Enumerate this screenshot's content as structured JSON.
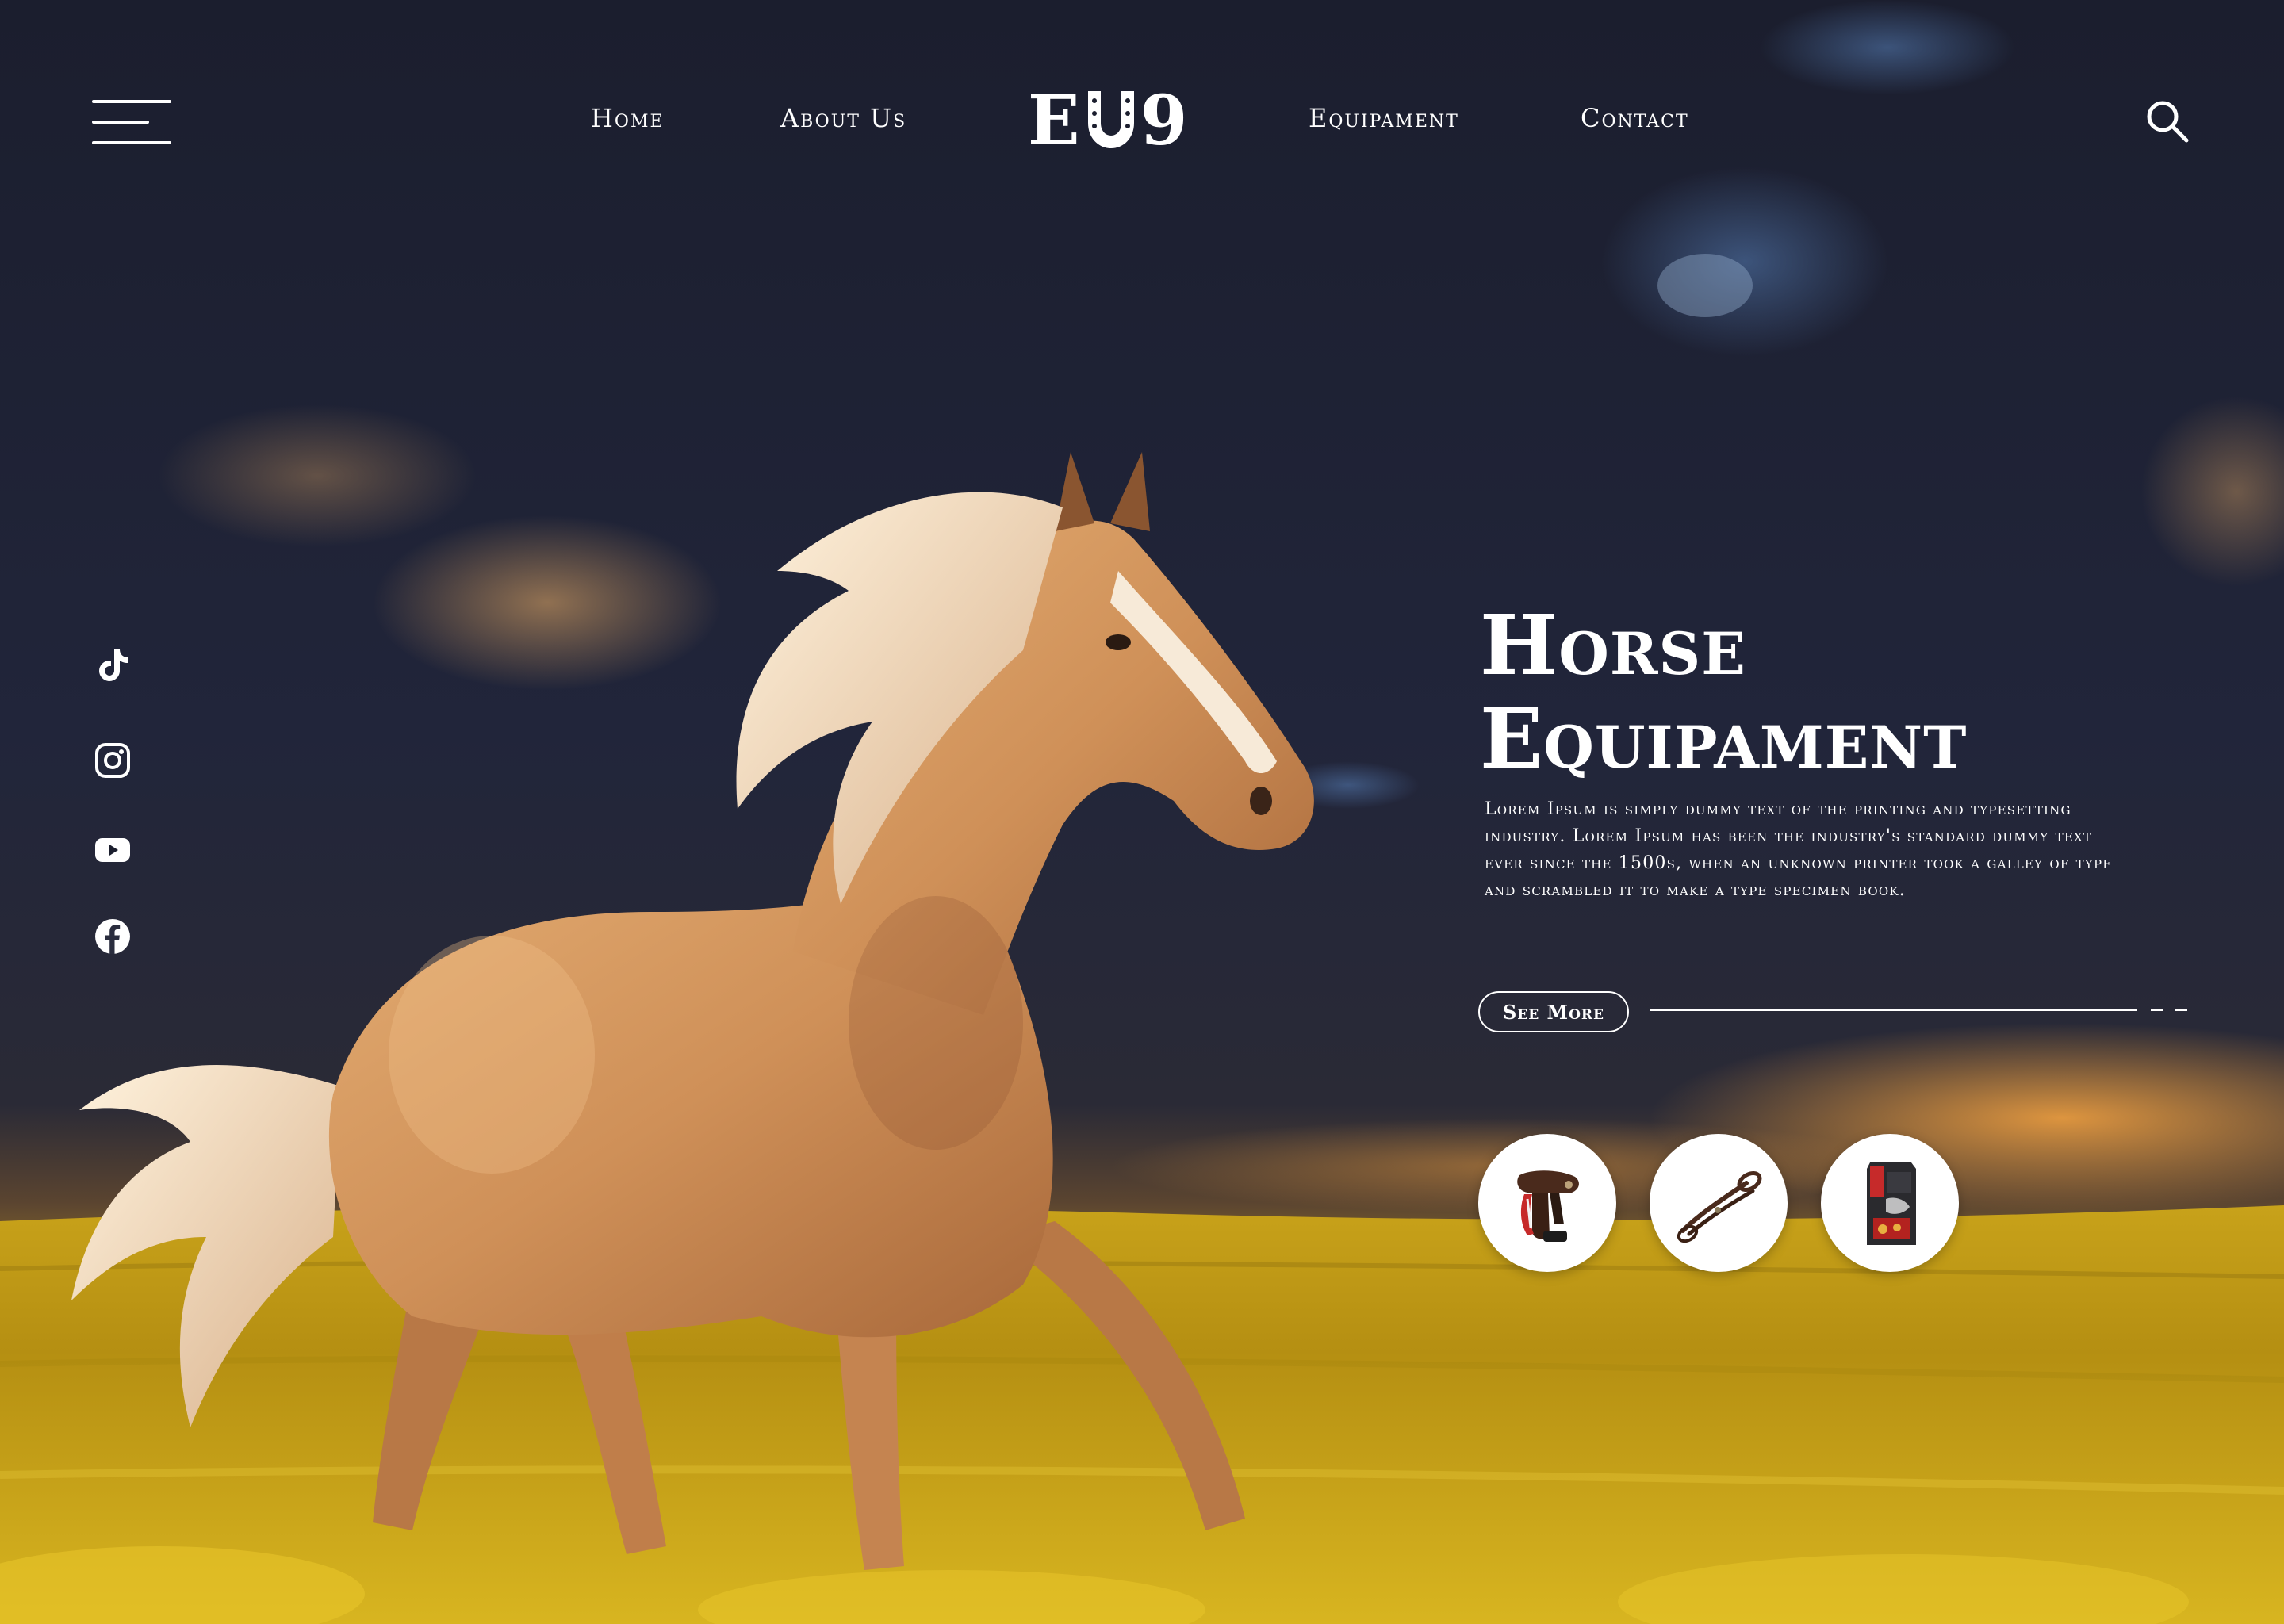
{
  "header": {
    "menu_icon": "hamburger-menu-icon",
    "nav": [
      {
        "label": "Home"
      },
      {
        "label": "About Us"
      },
      {
        "label": "Equipament"
      },
      {
        "label": "Contact"
      }
    ],
    "logo": {
      "prefix": "E",
      "middle_icon": "horseshoe-icon",
      "suffix": "9"
    },
    "search_icon": "search-icon"
  },
  "social": [
    {
      "icon": "tiktok-icon"
    },
    {
      "icon": "instagram-icon"
    },
    {
      "icon": "youtube-icon"
    },
    {
      "icon": "facebook-icon"
    }
  ],
  "hero": {
    "title_line1": "Horse",
    "title_line2": "Equipament",
    "description": "Lorem Ipsum is simply dummy text of the printing and typesetting industry. Lorem Ipsum has been the industry's standard dummy  text ever since the 1500s, when an unknown printer took a galley of  type and scrambled it to make a type specimen book.",
    "cta_label": "See More"
  },
  "products": [
    {
      "icon": "saddle-icon"
    },
    {
      "icon": "reins-icon"
    },
    {
      "icon": "feed-bag-icon"
    }
  ],
  "colors": {
    "text": "#ffffff",
    "sky_dark": "#1b1e2e",
    "field_yellow": "#d6b21c",
    "horse": "#d39a63"
  }
}
